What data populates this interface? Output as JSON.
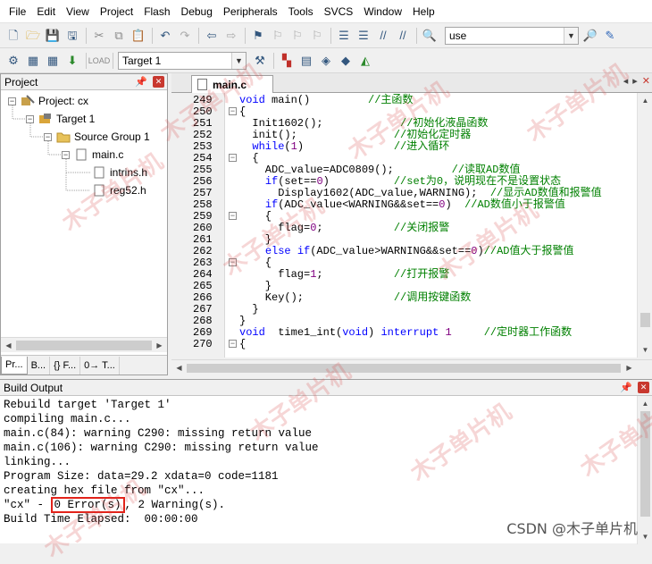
{
  "menu": [
    "File",
    "Edit",
    "View",
    "Project",
    "Flash",
    "Debug",
    "Peripherals",
    "Tools",
    "SVCS",
    "Window",
    "Help"
  ],
  "toolbar1": {
    "search_combo_value": "use"
  },
  "toolbar2": {
    "target_value": "Target 1"
  },
  "project_pane": {
    "title": "Project",
    "tree": {
      "project": "Project: cx",
      "target": "Target 1",
      "group": "Source Group 1",
      "file": "main.c",
      "headers": [
        "intrins.h",
        "reg52.h"
      ]
    },
    "tabs": [
      "Pr...",
      "B...",
      "{} F...",
      "0→ T..."
    ]
  },
  "editor": {
    "tab_label": "main.c",
    "lines": [
      {
        "ln": "249",
        "fold": "",
        "code": "void main()         //主函数"
      },
      {
        "ln": "250",
        "fold": "-",
        "code": "{"
      },
      {
        "ln": "251",
        "fold": "",
        "code": "  Init1602();            //初始化液晶函数"
      },
      {
        "ln": "252",
        "fold": "",
        "code": "  init();               //初始化定时器"
      },
      {
        "ln": "253",
        "fold": "",
        "code": "  while(1)              //进入循环"
      },
      {
        "ln": "254",
        "fold": "-",
        "code": "  {"
      },
      {
        "ln": "255",
        "fold": "",
        "code": "    ADC_value=ADC0809();         //读取AD数值"
      },
      {
        "ln": "256",
        "fold": "",
        "code": "    if(set==0)          //set为0，说明现在不是设置状态"
      },
      {
        "ln": "257",
        "fold": "",
        "code": "      Display1602(ADC_value,WARNING);  //显示AD数值和报警值"
      },
      {
        "ln": "258",
        "fold": "",
        "code": "    if(ADC_value<WARNING&&set==0)  //AD数值小于报警值"
      },
      {
        "ln": "259",
        "fold": "-",
        "code": "    {"
      },
      {
        "ln": "260",
        "fold": "",
        "code": "      flag=0;           //关闭报警"
      },
      {
        "ln": "261",
        "fold": "",
        "code": "    }"
      },
      {
        "ln": "262",
        "fold": "",
        "code": "    else if(ADC_value>WARNING&&set==0)//AD值大于报警值"
      },
      {
        "ln": "263",
        "fold": "-",
        "code": "    {"
      },
      {
        "ln": "264",
        "fold": "",
        "code": "      flag=1;           //打开报警"
      },
      {
        "ln": "265",
        "fold": "",
        "code": "    }"
      },
      {
        "ln": "266",
        "fold": "",
        "code": "    Key();              //调用按键函数"
      },
      {
        "ln": "267",
        "fold": "",
        "code": "  }"
      },
      {
        "ln": "268",
        "fold": "",
        "code": "}"
      },
      {
        "ln": "269",
        "fold": "",
        "code": "void  time1_int(void) interrupt 1     //定时器工作函数"
      },
      {
        "ln": "270",
        "fold": "-",
        "code": "{"
      }
    ]
  },
  "build_output": {
    "title": "Build Output",
    "lines": [
      "Rebuild target 'Target 1'",
      "compiling main.c...",
      "main.c(84): warning C290: missing return value",
      "main.c(106): warning C290: missing return value",
      "linking...",
      "Program Size: data=29.2 xdata=0 code=1181",
      "creating hex file from \"cx\"..."
    ],
    "result_prefix": "\"cx\" - ",
    "result_errors": "0 Error(s)",
    "result_suffix": ", 2 Warning(s).",
    "elapsed": "Build Time Elapsed:  00:00:00"
  },
  "watermark_text": "木子单片机",
  "credit": "CSDN @木子单片机",
  "colors": {
    "keyword": "#0000ff",
    "comment": "#008000",
    "number": "#800080",
    "error_box": "#e2231a"
  }
}
